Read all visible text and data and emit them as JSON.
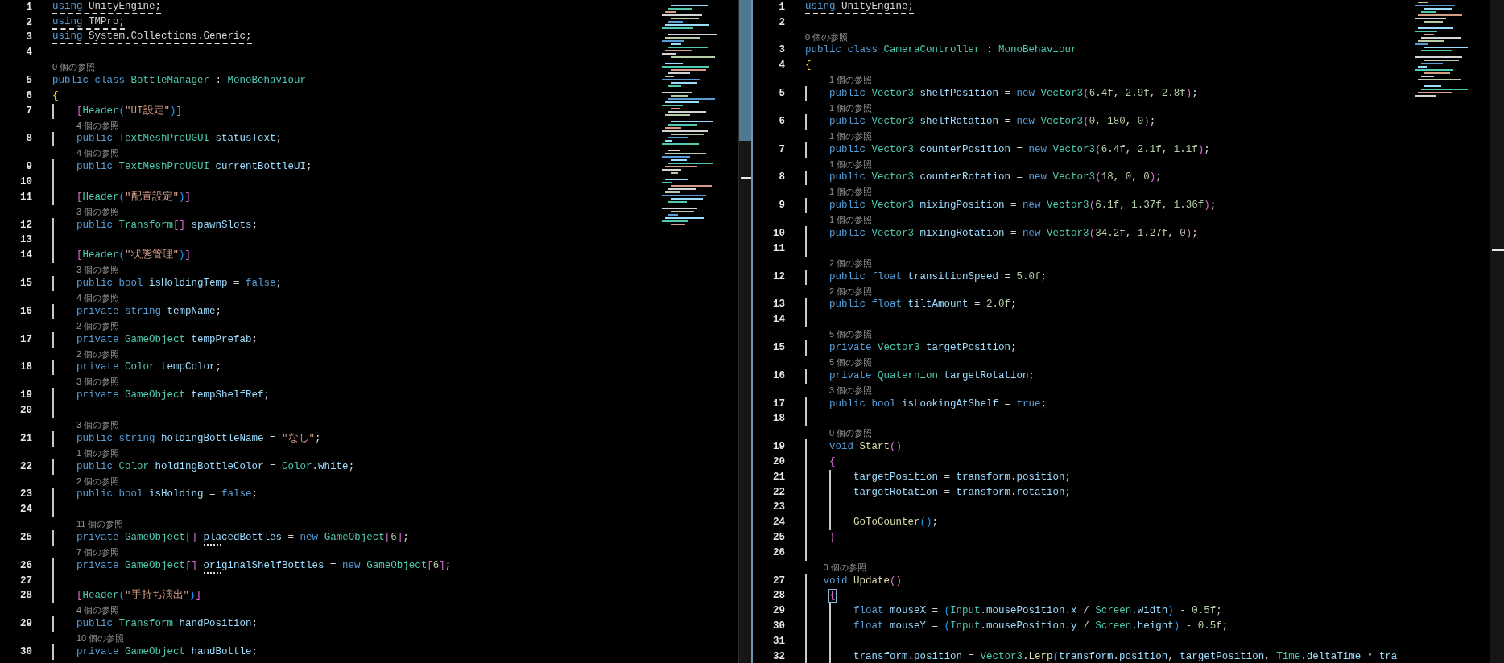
{
  "panes": [
    {
      "lines": [
        {
          "number": "1",
          "underlined": true,
          "tokens": [
            {
              "kind": "keyword",
              "text": "using"
            },
            {
              "kind": "plain",
              "text": " UnityEngine;"
            }
          ]
        },
        {
          "number": "2",
          "underlined": true,
          "tokens": [
            {
              "kind": "keyword",
              "text": "using"
            },
            {
              "kind": "plain",
              "text": " TMPro;"
            }
          ]
        },
        {
          "number": "3",
          "underlined": true,
          "tokens": [
            {
              "kind": "keyword",
              "text": "using"
            },
            {
              "kind": "plain",
              "text": " System.Collections.Generic;"
            }
          ]
        },
        {
          "number": "4"
        },
        {
          "number": "5",
          "references": "0 個の参照",
          "tokens": [
            {
              "kind": "keyword",
              "text": "public class "
            },
            {
              "kind": "type",
              "text": "BottleManager"
            },
            {
              "kind": "plain",
              "text": " : "
            },
            {
              "kind": "type",
              "text": "MonoBehaviour"
            }
          ]
        },
        {
          "number": "6",
          "tokens": [
            {
              "kind": "bracket_gold",
              "text": "{"
            }
          ]
        },
        {
          "number": "7",
          "tokens": [
            {
              "kind": "bracket_pink",
              "text": "    ["
            },
            {
              "kind": "type",
              "text": "Header"
            },
            {
              "kind": "bracket_blue",
              "text": "("
            },
            {
              "kind": "string",
              "text": "\"UI設定\""
            },
            {
              "kind": "bracket_blue",
              "text": ")"
            },
            {
              "kind": "bracket_pink",
              "text": "]"
            }
          ]
        },
        {
          "number": "8",
          "references": "4 個の参照",
          "tokens": [
            {
              "kind": "keyword",
              "text": "    public "
            },
            {
              "kind": "type",
              "text": "TextMeshProUGUI"
            },
            {
              "kind": "field",
              "text": " statusText"
            },
            {
              "kind": "plain",
              "text": ";"
            }
          ]
        },
        {
          "number": "9",
          "references": "4 個の参照",
          "tokens": [
            {
              "kind": "keyword",
              "text": "    public "
            },
            {
              "kind": "type",
              "text": "TextMeshProUGUI"
            },
            {
              "kind": "field",
              "text": " currentBottleUI"
            },
            {
              "kind": "plain",
              "text": ";"
            }
          ]
        },
        {
          "number": "10"
        },
        {
          "number": "11",
          "tokens": [
            {
              "kind": "bracket_pink",
              "text": "    ["
            },
            {
              "kind": "type",
              "text": "Header"
            },
            {
              "kind": "bracket_blue",
              "text": "("
            },
            {
              "kind": "string",
              "text": "\"配置設定\""
            },
            {
              "kind": "bracket_blue",
              "text": ")"
            },
            {
              "kind": "bracket_pink",
              "text": "]"
            }
          ]
        },
        {
          "number": "12",
          "references": "3 個の参照",
          "tokens": [
            {
              "kind": "keyword",
              "text": "    public "
            },
            {
              "kind": "type",
              "text": "Transform"
            },
            {
              "kind": "bracket_pink",
              "text": "[]"
            },
            {
              "kind": "field",
              "text": " spawnSlots"
            },
            {
              "kind": "plain",
              "text": ";"
            }
          ]
        },
        {
          "number": "13"
        },
        {
          "number": "14",
          "tokens": [
            {
              "kind": "bracket_pink",
              "text": "    ["
            },
            {
              "kind": "type",
              "text": "Header"
            },
            {
              "kind": "bracket_blue",
              "text": "("
            },
            {
              "kind": "string",
              "text": "\"状態管理\""
            },
            {
              "kind": "bracket_blue",
              "text": ")"
            },
            {
              "kind": "bracket_pink",
              "text": "]"
            }
          ]
        },
        {
          "number": "15",
          "references": "3 個の参照",
          "tokens": [
            {
              "kind": "keyword",
              "text": "    public bool"
            },
            {
              "kind": "field",
              "text": " isHoldingTemp"
            },
            {
              "kind": "plain",
              "text": " = "
            },
            {
              "kind": "keyword",
              "text": "false"
            },
            {
              "kind": "plain",
              "text": ";"
            }
          ]
        },
        {
          "number": "16",
          "references": "4 個の参照",
          "tokens": [
            {
              "kind": "keyword",
              "text": "    private string"
            },
            {
              "kind": "field",
              "text": " tempName"
            },
            {
              "kind": "plain",
              "text": ";"
            }
          ]
        },
        {
          "number": "17",
          "references": "2 個の参照",
          "tokens": [
            {
              "kind": "keyword",
              "text": "    private "
            },
            {
              "kind": "type",
              "text": "GameObject"
            },
            {
              "kind": "field",
              "text": " tempPrefab"
            },
            {
              "kind": "plain",
              "text": ";"
            }
          ]
        },
        {
          "number": "18",
          "references": "2 個の参照",
          "tokens": [
            {
              "kind": "keyword",
              "text": "    private "
            },
            {
              "kind": "type",
              "text": "Color"
            },
            {
              "kind": "field",
              "text": " tempColor"
            },
            {
              "kind": "plain",
              "text": ";"
            }
          ]
        },
        {
          "number": "19",
          "references": "3 個の参照",
          "tokens": [
            {
              "kind": "keyword",
              "text": "    private "
            },
            {
              "kind": "type",
              "text": "GameObject"
            },
            {
              "kind": "field",
              "text": " tempShelfRef"
            },
            {
              "kind": "plain",
              "text": ";"
            }
          ]
        },
        {
          "number": "20"
        },
        {
          "number": "21",
          "references": "3 個の参照",
          "tokens": [
            {
              "kind": "keyword",
              "text": "    public string"
            },
            {
              "kind": "field",
              "text": " holdingBottleName"
            },
            {
              "kind": "plain",
              "text": " = "
            },
            {
              "kind": "string",
              "text": "\"なし\""
            },
            {
              "kind": "plain",
              "text": ";"
            }
          ]
        },
        {
          "number": "22",
          "references": "1 個の参照",
          "tokens": [
            {
              "kind": "keyword",
              "text": "    public "
            },
            {
              "kind": "type",
              "text": "Color"
            },
            {
              "kind": "field",
              "text": " holdingBottleColor"
            },
            {
              "kind": "plain",
              "text": " = "
            },
            {
              "kind": "type",
              "text": "Color"
            },
            {
              "kind": "field",
              "text": ".white"
            },
            {
              "kind": "plain",
              "text": ";"
            }
          ]
        },
        {
          "number": "23",
          "references": "2 個の参照",
          "tokens": [
            {
              "kind": "keyword",
              "text": "    public bool"
            },
            {
              "kind": "field",
              "text": " isHolding"
            },
            {
              "kind": "plain",
              "text": " = "
            },
            {
              "kind": "keyword",
              "text": "false"
            },
            {
              "kind": "plain",
              "text": ";"
            }
          ]
        },
        {
          "number": "24"
        },
        {
          "number": "25",
          "references": "11 個の参照",
          "tokens": [
            {
              "kind": "keyword",
              "text": "    private "
            },
            {
              "kind": "type",
              "text": "GameObject"
            },
            {
              "kind": "bracket_pink",
              "text": "[] "
            },
            {
              "kind": "field",
              "text": "placedBottles",
              "suggestion": true
            },
            {
              "kind": "plain",
              "text": " = "
            },
            {
              "kind": "keyword",
              "text": "new "
            },
            {
              "kind": "type",
              "text": "GameObject"
            },
            {
              "kind": "bracket_pink",
              "text": "["
            },
            {
              "kind": "number",
              "text": "6"
            },
            {
              "kind": "bracket_pink",
              "text": "]"
            },
            {
              "kind": "plain",
              "text": ";"
            }
          ]
        },
        {
          "number": "26",
          "references": "7 個の参照",
          "tokens": [
            {
              "kind": "keyword",
              "text": "    private "
            },
            {
              "kind": "type",
              "text": "GameObject"
            },
            {
              "kind": "bracket_pink",
              "text": "[] "
            },
            {
              "kind": "field",
              "text": "originalShelfBottles",
              "suggestion": true
            },
            {
              "kind": "plain",
              "text": " = "
            },
            {
              "kind": "keyword",
              "text": "new "
            },
            {
              "kind": "type",
              "text": "GameObject"
            },
            {
              "kind": "bracket_pink",
              "text": "["
            },
            {
              "kind": "number",
              "text": "6"
            },
            {
              "kind": "bracket_pink",
              "text": "]"
            },
            {
              "kind": "plain",
              "text": ";"
            }
          ]
        },
        {
          "number": "27"
        },
        {
          "number": "28",
          "tokens": [
            {
              "kind": "bracket_pink",
              "text": "    ["
            },
            {
              "kind": "type",
              "text": "Header"
            },
            {
              "kind": "bracket_blue",
              "text": "("
            },
            {
              "kind": "string",
              "text": "\"手持ち演出\""
            },
            {
              "kind": "bracket_blue",
              "text": ")"
            },
            {
              "kind": "bracket_pink",
              "text": "]"
            }
          ]
        },
        {
          "number": "29",
          "references": "4 個の参照",
          "tokens": [
            {
              "kind": "keyword",
              "text": "    public "
            },
            {
              "kind": "type",
              "text": "Transform"
            },
            {
              "kind": "field",
              "text": " handPosition"
            },
            {
              "kind": "plain",
              "text": ";"
            }
          ]
        },
        {
          "number": "30",
          "references": "10 個の参照",
          "tokens": [
            {
              "kind": "keyword",
              "text": "    private "
            },
            {
              "kind": "type",
              "text": "GameObject"
            },
            {
              "kind": "field",
              "text": " handBottle"
            },
            {
              "kind": "plain",
              "text": ";"
            }
          ]
        }
      ]
    },
    {
      "lines": [
        {
          "number": "1",
          "underlined": true,
          "tokens": [
            {
              "kind": "keyword",
              "text": "using"
            },
            {
              "kind": "plain",
              "text": " UnityEngine;"
            }
          ]
        },
        {
          "number": "2"
        },
        {
          "number": "3",
          "references": "0 個の参照",
          "tokens": [
            {
              "kind": "keyword",
              "text": "public class "
            },
            {
              "kind": "type",
              "text": "CameraController"
            },
            {
              "kind": "plain",
              "text": " : "
            },
            {
              "kind": "type",
              "text": "MonoBehaviour"
            }
          ]
        },
        {
          "number": "4",
          "tokens": [
            {
              "kind": "bracket_gold",
              "text": "{"
            }
          ]
        },
        {
          "number": "5",
          "references": "1 個の参照",
          "tokens": [
            {
              "kind": "keyword",
              "text": "    public "
            },
            {
              "kind": "type",
              "text": "Vector3"
            },
            {
              "kind": "field",
              "text": " shelfPosition"
            },
            {
              "kind": "plain",
              "text": " = "
            },
            {
              "kind": "keyword",
              "text": "new "
            },
            {
              "kind": "type",
              "text": "Vector3"
            },
            {
              "kind": "bracket_pink",
              "text": "("
            },
            {
              "kind": "number",
              "text": "6.4f"
            },
            {
              "kind": "plain",
              "text": ", "
            },
            {
              "kind": "number",
              "text": "2.9f"
            },
            {
              "kind": "plain",
              "text": ", "
            },
            {
              "kind": "number",
              "text": "2.8f"
            },
            {
              "kind": "bracket_pink",
              "text": ")"
            },
            {
              "kind": "plain",
              "text": ";"
            }
          ]
        },
        {
          "number": "6",
          "references": "1 個の参照",
          "tokens": [
            {
              "kind": "keyword",
              "text": "    public "
            },
            {
              "kind": "type",
              "text": "Vector3"
            },
            {
              "kind": "field",
              "text": " shelfRotation"
            },
            {
              "kind": "plain",
              "text": " = "
            },
            {
              "kind": "keyword",
              "text": "new "
            },
            {
              "kind": "type",
              "text": "Vector3"
            },
            {
              "kind": "bracket_pink",
              "text": "("
            },
            {
              "kind": "number",
              "text": "0"
            },
            {
              "kind": "plain",
              "text": ", "
            },
            {
              "kind": "number",
              "text": "180"
            },
            {
              "kind": "plain",
              "text": ", "
            },
            {
              "kind": "number",
              "text": "0"
            },
            {
              "kind": "bracket_pink",
              "text": ")"
            },
            {
              "kind": "plain",
              "text": ";"
            }
          ]
        },
        {
          "number": "7",
          "references": "1 個の参照",
          "tokens": [
            {
              "kind": "keyword",
              "text": "    public "
            },
            {
              "kind": "type",
              "text": "Vector3"
            },
            {
              "kind": "field",
              "text": " counterPosition"
            },
            {
              "kind": "plain",
              "text": " = "
            },
            {
              "kind": "keyword",
              "text": "new "
            },
            {
              "kind": "type",
              "text": "Vector3"
            },
            {
              "kind": "bracket_pink",
              "text": "("
            },
            {
              "kind": "number",
              "text": "6.4f"
            },
            {
              "kind": "plain",
              "text": ", "
            },
            {
              "kind": "number",
              "text": "2.1f"
            },
            {
              "kind": "plain",
              "text": ", "
            },
            {
              "kind": "number",
              "text": "1.1f"
            },
            {
              "kind": "bracket_pink",
              "text": ")"
            },
            {
              "kind": "plain",
              "text": ";"
            }
          ]
        },
        {
          "number": "8",
          "references": "1 個の参照",
          "tokens": [
            {
              "kind": "keyword",
              "text": "    public "
            },
            {
              "kind": "type",
              "text": "Vector3"
            },
            {
              "kind": "field",
              "text": " counterRotation"
            },
            {
              "kind": "plain",
              "text": " = "
            },
            {
              "kind": "keyword",
              "text": "new "
            },
            {
              "kind": "type",
              "text": "Vector3"
            },
            {
              "kind": "bracket_pink",
              "text": "("
            },
            {
              "kind": "number",
              "text": "18"
            },
            {
              "kind": "plain",
              "text": ", "
            },
            {
              "kind": "number",
              "text": "0"
            },
            {
              "kind": "plain",
              "text": ", "
            },
            {
              "kind": "number",
              "text": "0"
            },
            {
              "kind": "bracket_pink",
              "text": ")"
            },
            {
              "kind": "plain",
              "text": ";"
            }
          ]
        },
        {
          "number": "9",
          "references": "1 個の参照",
          "tokens": [
            {
              "kind": "keyword",
              "text": "    public "
            },
            {
              "kind": "type",
              "text": "Vector3"
            },
            {
              "kind": "field",
              "text": " mixingPosition"
            },
            {
              "kind": "plain",
              "text": " = "
            },
            {
              "kind": "keyword",
              "text": "new "
            },
            {
              "kind": "type",
              "text": "Vector3"
            },
            {
              "kind": "bracket_pink",
              "text": "("
            },
            {
              "kind": "number",
              "text": "6.1f"
            },
            {
              "kind": "plain",
              "text": ", "
            },
            {
              "kind": "number",
              "text": "1.37f"
            },
            {
              "kind": "plain",
              "text": ", "
            },
            {
              "kind": "number",
              "text": "1.36f"
            },
            {
              "kind": "bracket_pink",
              "text": ")"
            },
            {
              "kind": "plain",
              "text": ";"
            }
          ]
        },
        {
          "number": "10",
          "references": "1 個の参照",
          "tokens": [
            {
              "kind": "keyword",
              "text": "    public "
            },
            {
              "kind": "type",
              "text": "Vector3"
            },
            {
              "kind": "field",
              "text": " mixingRotation"
            },
            {
              "kind": "plain",
              "text": " = "
            },
            {
              "kind": "keyword",
              "text": "new "
            },
            {
              "kind": "type",
              "text": "Vector3"
            },
            {
              "kind": "bracket_pink",
              "text": "("
            },
            {
              "kind": "number",
              "text": "34.2f"
            },
            {
              "kind": "plain",
              "text": ", "
            },
            {
              "kind": "number",
              "text": "1.27f"
            },
            {
              "kind": "plain",
              "text": ", "
            },
            {
              "kind": "number",
              "text": "0"
            },
            {
              "kind": "bracket_pink",
              "text": ")"
            },
            {
              "kind": "plain",
              "text": ";"
            }
          ]
        },
        {
          "number": "11"
        },
        {
          "number": "12",
          "references": "2 個の参照",
          "tokens": [
            {
              "kind": "keyword",
              "text": "    public float"
            },
            {
              "kind": "field",
              "text": " transitionSpeed"
            },
            {
              "kind": "plain",
              "text": " = "
            },
            {
              "kind": "number",
              "text": "5.0f"
            },
            {
              "kind": "plain",
              "text": ";"
            }
          ]
        },
        {
          "number": "13",
          "references": "2 個の参照",
          "tokens": [
            {
              "kind": "keyword",
              "text": "    public float"
            },
            {
              "kind": "field",
              "text": " tiltAmount"
            },
            {
              "kind": "plain",
              "text": " = "
            },
            {
              "kind": "number",
              "text": "2.0f"
            },
            {
              "kind": "plain",
              "text": ";"
            }
          ]
        },
        {
          "number": "14"
        },
        {
          "number": "15",
          "references": "5 個の参照",
          "tokens": [
            {
              "kind": "keyword",
              "text": "    private "
            },
            {
              "kind": "type",
              "text": "Vector3"
            },
            {
              "kind": "field",
              "text": " targetPosition"
            },
            {
              "kind": "plain",
              "text": ";"
            }
          ]
        },
        {
          "number": "16",
          "references": "5 個の参照",
          "tokens": [
            {
              "kind": "keyword",
              "text": "    private "
            },
            {
              "kind": "type",
              "text": "Quaternion"
            },
            {
              "kind": "field",
              "text": " targetRotation"
            },
            {
              "kind": "plain",
              "text": ";"
            }
          ]
        },
        {
          "number": "17",
          "references": "3 個の参照",
          "tokens": [
            {
              "kind": "keyword",
              "text": "    public bool"
            },
            {
              "kind": "field",
              "text": " isLookingAtShelf"
            },
            {
              "kind": "plain",
              "text": " = "
            },
            {
              "kind": "keyword",
              "text": "true"
            },
            {
              "kind": "plain",
              "text": ";"
            }
          ]
        },
        {
          "number": "18"
        },
        {
          "number": "19",
          "references": "0 個の参照",
          "tokens": [
            {
              "kind": "keyword",
              "text": "    void "
            },
            {
              "kind": "function",
              "text": "Start"
            },
            {
              "kind": "bracket_pink",
              "text": "()"
            }
          ]
        },
        {
          "number": "20",
          "tokens": [
            {
              "kind": "bracket_pink",
              "text": "    {"
            }
          ]
        },
        {
          "number": "21",
          "tokens": [
            {
              "kind": "field",
              "text": "        targetPosition"
            },
            {
              "kind": "plain",
              "text": " = "
            },
            {
              "kind": "field",
              "text": "transform.position"
            },
            {
              "kind": "plain",
              "text": ";"
            }
          ]
        },
        {
          "number": "22",
          "tokens": [
            {
              "kind": "field",
              "text": "        targetRotation"
            },
            {
              "kind": "plain",
              "text": " = "
            },
            {
              "kind": "field",
              "text": "transform.rotation"
            },
            {
              "kind": "plain",
              "text": ";"
            }
          ]
        },
        {
          "number": "23"
        },
        {
          "number": "24",
          "tokens": [
            {
              "kind": "function",
              "text": "        GoToCounter"
            },
            {
              "kind": "bracket_blue",
              "text": "()"
            },
            {
              "kind": "plain",
              "text": ";"
            }
          ]
        },
        {
          "number": "25",
          "tokens": [
            {
              "kind": "bracket_pink",
              "text": "    }"
            }
          ]
        },
        {
          "number": "26"
        },
        {
          "number": "27",
          "references": "0 個の参照",
          "tokens": [
            {
              "kind": "keyword",
              "text": "   void "
            },
            {
              "kind": "function",
              "text": "Update"
            },
            {
              "kind": "bracket_pink",
              "text": "()"
            }
          ]
        },
        {
          "number": "28",
          "highlight": true,
          "tokens": [
            {
              "kind": "bracket_pink",
              "text": "    {"
            }
          ]
        },
        {
          "number": "29",
          "tokens": [
            {
              "kind": "keyword",
              "text": "        float"
            },
            {
              "kind": "field",
              "text": " mouseX"
            },
            {
              "kind": "plain",
              "text": " = "
            },
            {
              "kind": "bracket_blue",
              "text": "("
            },
            {
              "kind": "type",
              "text": "Input"
            },
            {
              "kind": "field",
              "text": ".mousePosition.x"
            },
            {
              "kind": "plain",
              "text": " / "
            },
            {
              "kind": "type",
              "text": "Screen"
            },
            {
              "kind": "field",
              "text": ".width"
            },
            {
              "kind": "bracket_blue",
              "text": ")"
            },
            {
              "kind": "plain",
              "text": " - "
            },
            {
              "kind": "number",
              "text": "0.5f"
            },
            {
              "kind": "plain",
              "text": ";"
            }
          ]
        },
        {
          "number": "30",
          "tokens": [
            {
              "kind": "keyword",
              "text": "        float"
            },
            {
              "kind": "field",
              "text": " mouseY"
            },
            {
              "kind": "plain",
              "text": " = "
            },
            {
              "kind": "bracket_blue",
              "text": "("
            },
            {
              "kind": "type",
              "text": "Input"
            },
            {
              "kind": "field",
              "text": ".mousePosition.y"
            },
            {
              "kind": "plain",
              "text": " / "
            },
            {
              "kind": "type",
              "text": "Screen"
            },
            {
              "kind": "field",
              "text": ".height"
            },
            {
              "kind": "bracket_blue",
              "text": ")"
            },
            {
              "kind": "plain",
              "text": " - "
            },
            {
              "kind": "number",
              "text": "0.5f"
            },
            {
              "kind": "plain",
              "text": ";"
            }
          ]
        },
        {
          "number": "31"
        },
        {
          "number": "32",
          "tokens": [
            {
              "kind": "field",
              "text": "        transform.position"
            },
            {
              "kind": "plain",
              "text": " = "
            },
            {
              "kind": "type",
              "text": "Vector3"
            },
            {
              "kind": "function",
              "text": ".Lerp"
            },
            {
              "kind": "bracket_blue",
              "text": "("
            },
            {
              "kind": "field",
              "text": "transform.position"
            },
            {
              "kind": "plain",
              "text": ", "
            },
            {
              "kind": "field",
              "text": "targetPosition"
            },
            {
              "kind": "plain",
              "text": ", "
            },
            {
              "kind": "type",
              "text": "Time"
            },
            {
              "kind": "field",
              "text": ".deltaTime"
            },
            {
              "kind": "plain",
              "text": " * "
            },
            {
              "kind": "field",
              "text": "tra"
            }
          ]
        }
      ]
    }
  ]
}
